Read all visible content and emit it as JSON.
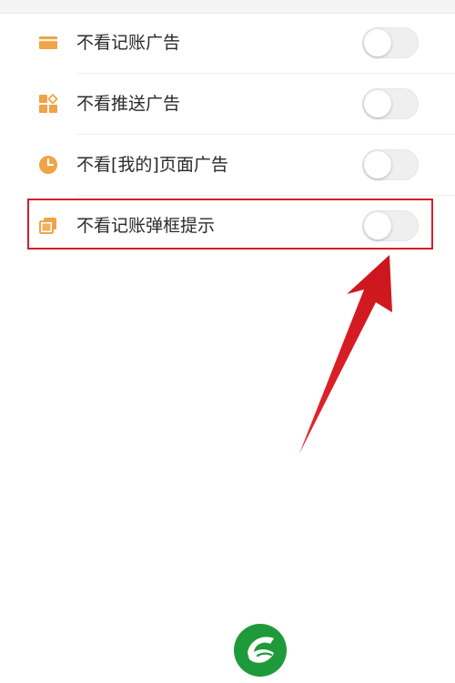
{
  "settings": {
    "items": [
      {
        "label": "不看记账广告",
        "icon": "card-icon",
        "enabled": false
      },
      {
        "label": "不看推送广告",
        "icon": "apps-icon",
        "enabled": false
      },
      {
        "label": "不看[我的]页面广告",
        "icon": "clock-icon",
        "enabled": false
      },
      {
        "label": "不看记账弹框提示",
        "icon": "layers-icon",
        "enabled": false
      }
    ]
  },
  "annotation": {
    "highlighted_item": "不看记账弹框提示",
    "color": "#d21f2a"
  },
  "colors": {
    "icon_accent": "#f0a347",
    "toggle_off": "#efefef",
    "logo_green": "#1f9a3a"
  }
}
